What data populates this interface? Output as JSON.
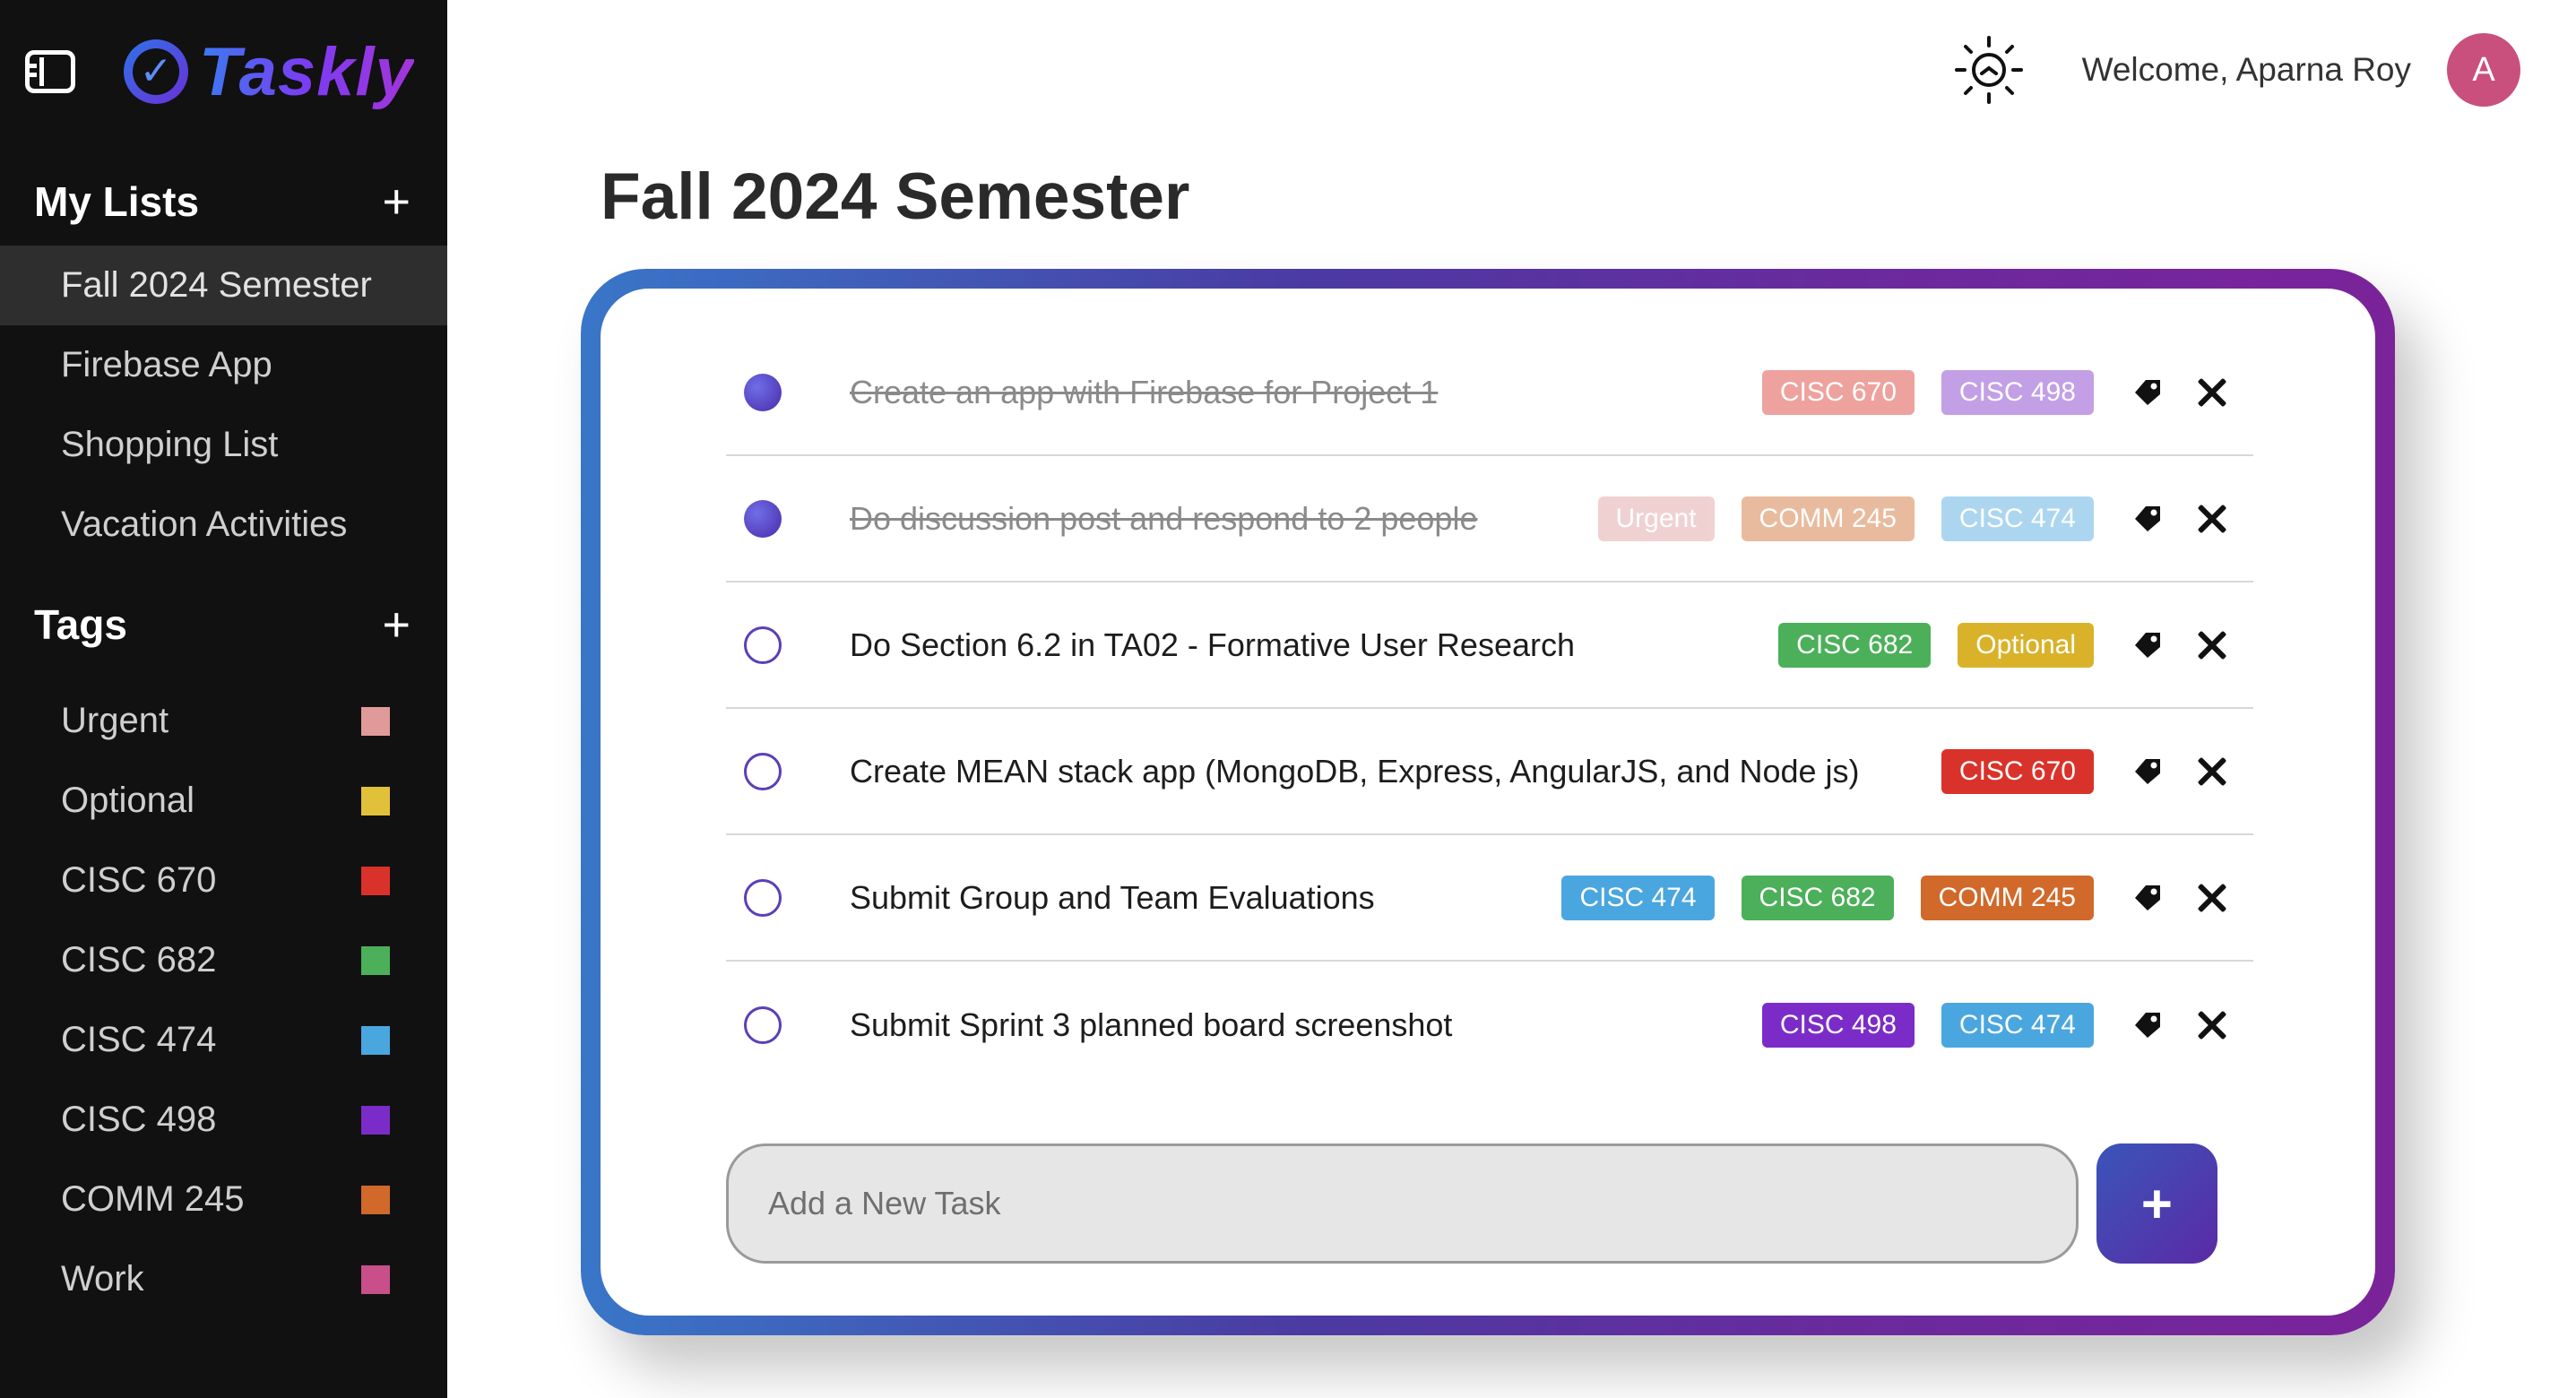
{
  "app": {
    "name": "Taskly"
  },
  "sidebar": {
    "lists_title": "My Lists",
    "lists": [
      {
        "label": "Fall 2024 Semester",
        "active": true
      },
      {
        "label": "Firebase App"
      },
      {
        "label": "Shopping List"
      },
      {
        "label": "Vacation Activities"
      }
    ],
    "tags_title": "Tags",
    "tags": [
      {
        "label": "Urgent",
        "color": "#e09a9a"
      },
      {
        "label": "Optional",
        "color": "#e2c13a"
      },
      {
        "label": "CISC 670",
        "color": "#d9322a"
      },
      {
        "label": "CISC 682",
        "color": "#4caf5a"
      },
      {
        "label": "CISC 474",
        "color": "#4aa6de"
      },
      {
        "label": "CISC 498",
        "color": "#7b2cc8"
      },
      {
        "label": "COMM 245",
        "color": "#d0692a"
      },
      {
        "label": "Work",
        "color": "#c94f8a"
      }
    ]
  },
  "header": {
    "welcome": "Welcome, Aparna Roy",
    "avatar_initial": "A",
    "theme_icon": "sun-icon"
  },
  "main": {
    "title": "Fall 2024 Semester",
    "tasks": [
      {
        "text": "Create an app with Firebase for Project 1",
        "completed": true,
        "tags": [
          {
            "label": "CISC 670",
            "color": "#d9322a"
          },
          {
            "label": "CISC 498",
            "color": "#7b2cc8"
          }
        ]
      },
      {
        "text": "Do discussion post and respond to 2 people",
        "completed": true,
        "tags": [
          {
            "label": "Urgent",
            "color": "#e09a9a"
          },
          {
            "label": "COMM 245",
            "color": "#d0692a"
          },
          {
            "label": "CISC 474",
            "color": "#4aa6de"
          }
        ]
      },
      {
        "text": "Do Section 6.2 in TA02 - Formative User Research",
        "completed": false,
        "tags": [
          {
            "label": "CISC 682",
            "color": "#4caf5a"
          },
          {
            "label": "Optional",
            "color": "#d9b22a"
          }
        ]
      },
      {
        "text": "Create MEAN stack app (MongoDB, Express, AngularJS, and Node js)",
        "completed": false,
        "tags": [
          {
            "label": "CISC 670",
            "color": "#d9322a"
          }
        ]
      },
      {
        "text": "Submit Group and Team Evaluations",
        "completed": false,
        "tags": [
          {
            "label": "CISC 474",
            "color": "#4aa6de"
          },
          {
            "label": "CISC 682",
            "color": "#4caf5a"
          },
          {
            "label": "COMM 245",
            "color": "#d0692a"
          }
        ]
      },
      {
        "text": "Submit Sprint 3 planned board screenshot",
        "completed": false,
        "tags": [
          {
            "label": "CISC 498",
            "color": "#7b2cc8"
          },
          {
            "label": "CISC 474",
            "color": "#4aa6de"
          }
        ]
      }
    ],
    "add_placeholder": "Add a New Task",
    "add_button": "+"
  }
}
